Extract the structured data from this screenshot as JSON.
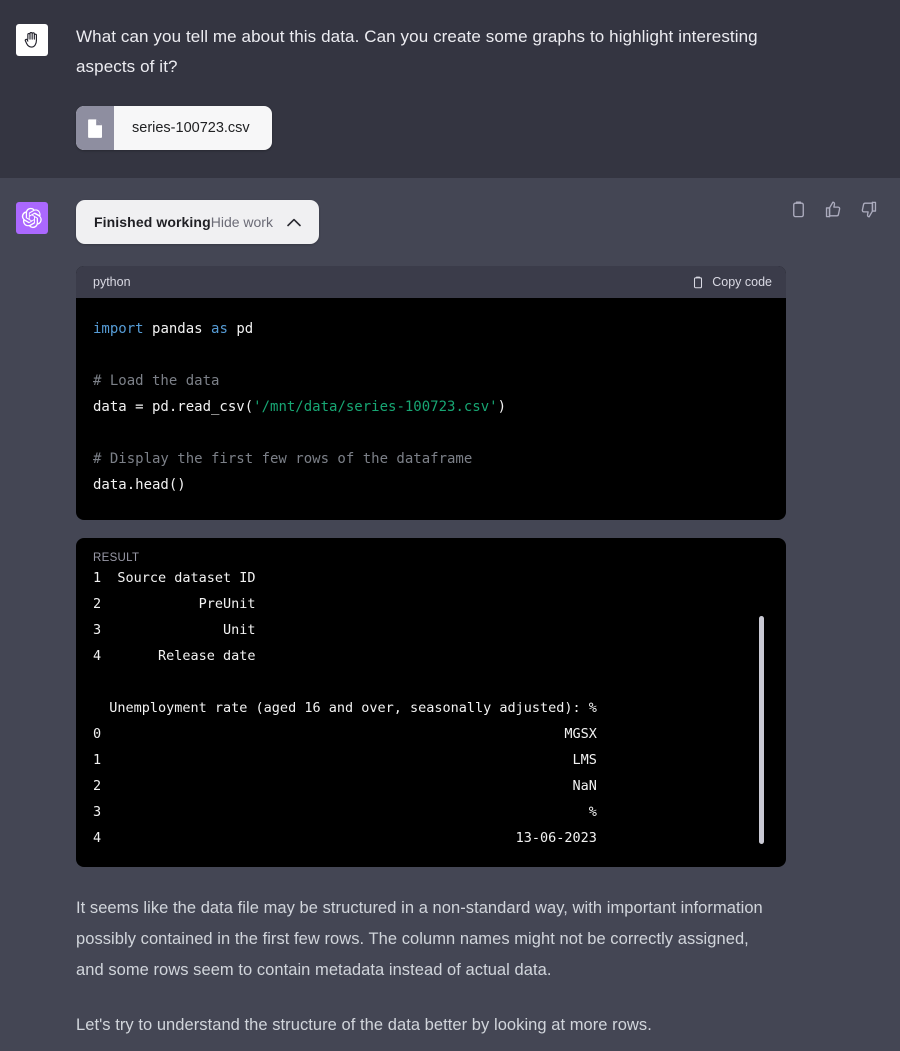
{
  "theme": {
    "user_bg": "#343541",
    "assistant_bg": "#444654",
    "code_bg": "#000000",
    "code_header_bg": "#3b3c4a",
    "accent_purple": "#ab68ff",
    "pill_bg": "#f0f0f2",
    "text_primary": "#ececf1",
    "text_secondary": "#d1d5db",
    "keyword": "#569cd6",
    "string": "#17a673",
    "comment": "#7c8088"
  },
  "user_turn": {
    "avatar_icon": "hand-palm-icon",
    "message": "What can you tell me about this data. Can you create some graphs to highlight interesting aspects of it?",
    "attachment": {
      "icon": "file-document-icon",
      "filename": "series-100723.csv"
    }
  },
  "assistant_turn": {
    "avatar_icon": "openai-logo-icon",
    "actions": [
      {
        "name": "copy-icon",
        "label": "Copy"
      },
      {
        "name": "thumbs-up-icon",
        "label": "Good response"
      },
      {
        "name": "thumbs-down-icon",
        "label": "Bad response"
      }
    ],
    "work_pill": {
      "status": "Finished working",
      "toggle_label": "Hide work",
      "chevron": "chevron-up-icon"
    },
    "code_block": {
      "language": "python",
      "copy_label": "Copy code",
      "copy_icon": "clipboard-icon",
      "lines": [
        [
          {
            "t": "import",
            "c": "kw"
          },
          {
            "t": " ",
            "c": "plain"
          },
          {
            "t": "pandas",
            "c": "plain"
          },
          {
            "t": " ",
            "c": "plain"
          },
          {
            "t": "as",
            "c": "kw"
          },
          {
            "t": " ",
            "c": "plain"
          },
          {
            "t": "pd",
            "c": "plain"
          }
        ],
        [],
        [
          {
            "t": "# Load the data",
            "c": "com"
          }
        ],
        [
          {
            "t": "data = pd.read_csv(",
            "c": "plain"
          },
          {
            "t": "'/mnt/data/series-100723.csv'",
            "c": "str"
          },
          {
            "t": ")",
            "c": "plain"
          }
        ],
        [],
        [
          {
            "t": "# Display the first few rows of the dataframe",
            "c": "com"
          }
        ],
        [
          {
            "t": "data.head()",
            "c": "plain"
          }
        ]
      ]
    },
    "result_block": {
      "label": "RESULT",
      "lines": [
        "1  Source dataset ID",
        "2            PreUnit",
        "3               Unit",
        "4       Release date",
        "",
        "  Unemployment rate (aged 16 and over, seasonally adjusted): %",
        "0                                                         MGSX",
        "1                                                          LMS",
        "2                                                          NaN",
        "3                                                            %",
        "4                                                   13-06-2023"
      ],
      "has_scrollbar": true
    },
    "paragraphs": [
      "It seems like the data file may be structured in a non-standard way, with important information possibly contained in the first few rows. The column names might not be correctly assigned, and some rows seem to contain metadata instead of actual data.",
      "Let's try to understand the structure of the data better by looking at more rows."
    ]
  }
}
